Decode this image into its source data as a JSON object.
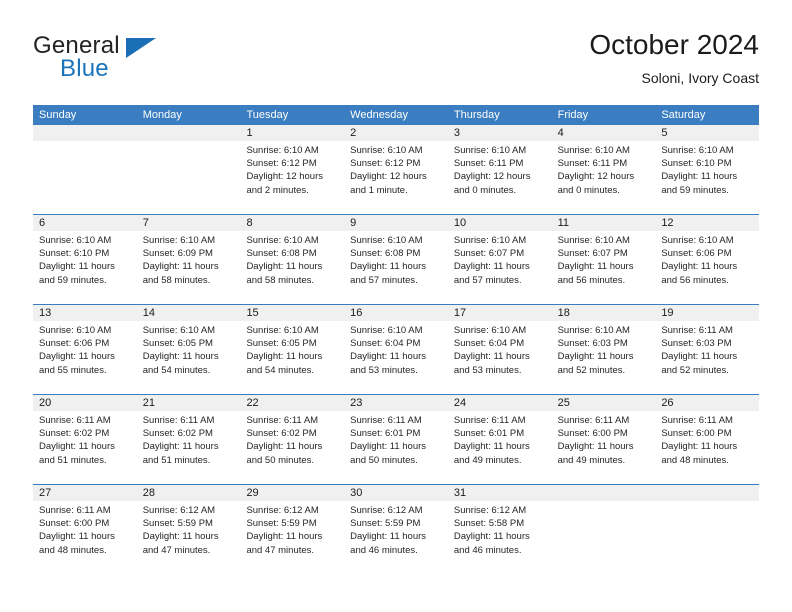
{
  "brand": {
    "word1": "General",
    "word2": "Blue",
    "triangle_color": "#1a6fb5",
    "blue_text_color": "#1a74bb"
  },
  "header": {
    "title": "October 2024",
    "subtitle": "Soloni, Ivory Coast"
  },
  "theme": {
    "header_blue": "#3a7dc0",
    "daynum_gray": "#f0f0f0",
    "text": "#262626"
  },
  "weekdays": [
    "Sunday",
    "Monday",
    "Tuesday",
    "Wednesday",
    "Thursday",
    "Friday",
    "Saturday"
  ],
  "weeks": [
    [
      {
        "day": "",
        "sunrise": "",
        "sunset": "",
        "daylight1": "",
        "daylight2": ""
      },
      {
        "day": "",
        "sunrise": "",
        "sunset": "",
        "daylight1": "",
        "daylight2": ""
      },
      {
        "day": "1",
        "sunrise": "Sunrise: 6:10 AM",
        "sunset": "Sunset: 6:12 PM",
        "daylight1": "Daylight: 12 hours",
        "daylight2": "and 2 minutes."
      },
      {
        "day": "2",
        "sunrise": "Sunrise: 6:10 AM",
        "sunset": "Sunset: 6:12 PM",
        "daylight1": "Daylight: 12 hours",
        "daylight2": "and 1 minute."
      },
      {
        "day": "3",
        "sunrise": "Sunrise: 6:10 AM",
        "sunset": "Sunset: 6:11 PM",
        "daylight1": "Daylight: 12 hours",
        "daylight2": "and 0 minutes."
      },
      {
        "day": "4",
        "sunrise": "Sunrise: 6:10 AM",
        "sunset": "Sunset: 6:11 PM",
        "daylight1": "Daylight: 12 hours",
        "daylight2": "and 0 minutes."
      },
      {
        "day": "5",
        "sunrise": "Sunrise: 6:10 AM",
        "sunset": "Sunset: 6:10 PM",
        "daylight1": "Daylight: 11 hours",
        "daylight2": "and 59 minutes."
      }
    ],
    [
      {
        "day": "6",
        "sunrise": "Sunrise: 6:10 AM",
        "sunset": "Sunset: 6:10 PM",
        "daylight1": "Daylight: 11 hours",
        "daylight2": "and 59 minutes."
      },
      {
        "day": "7",
        "sunrise": "Sunrise: 6:10 AM",
        "sunset": "Sunset: 6:09 PM",
        "daylight1": "Daylight: 11 hours",
        "daylight2": "and 58 minutes."
      },
      {
        "day": "8",
        "sunrise": "Sunrise: 6:10 AM",
        "sunset": "Sunset: 6:08 PM",
        "daylight1": "Daylight: 11 hours",
        "daylight2": "and 58 minutes."
      },
      {
        "day": "9",
        "sunrise": "Sunrise: 6:10 AM",
        "sunset": "Sunset: 6:08 PM",
        "daylight1": "Daylight: 11 hours",
        "daylight2": "and 57 minutes."
      },
      {
        "day": "10",
        "sunrise": "Sunrise: 6:10 AM",
        "sunset": "Sunset: 6:07 PM",
        "daylight1": "Daylight: 11 hours",
        "daylight2": "and 57 minutes."
      },
      {
        "day": "11",
        "sunrise": "Sunrise: 6:10 AM",
        "sunset": "Sunset: 6:07 PM",
        "daylight1": "Daylight: 11 hours",
        "daylight2": "and 56 minutes."
      },
      {
        "day": "12",
        "sunrise": "Sunrise: 6:10 AM",
        "sunset": "Sunset: 6:06 PM",
        "daylight1": "Daylight: 11 hours",
        "daylight2": "and 56 minutes."
      }
    ],
    [
      {
        "day": "13",
        "sunrise": "Sunrise: 6:10 AM",
        "sunset": "Sunset: 6:06 PM",
        "daylight1": "Daylight: 11 hours",
        "daylight2": "and 55 minutes."
      },
      {
        "day": "14",
        "sunrise": "Sunrise: 6:10 AM",
        "sunset": "Sunset: 6:05 PM",
        "daylight1": "Daylight: 11 hours",
        "daylight2": "and 54 minutes."
      },
      {
        "day": "15",
        "sunrise": "Sunrise: 6:10 AM",
        "sunset": "Sunset: 6:05 PM",
        "daylight1": "Daylight: 11 hours",
        "daylight2": "and 54 minutes."
      },
      {
        "day": "16",
        "sunrise": "Sunrise: 6:10 AM",
        "sunset": "Sunset: 6:04 PM",
        "daylight1": "Daylight: 11 hours",
        "daylight2": "and 53 minutes."
      },
      {
        "day": "17",
        "sunrise": "Sunrise: 6:10 AM",
        "sunset": "Sunset: 6:04 PM",
        "daylight1": "Daylight: 11 hours",
        "daylight2": "and 53 minutes."
      },
      {
        "day": "18",
        "sunrise": "Sunrise: 6:10 AM",
        "sunset": "Sunset: 6:03 PM",
        "daylight1": "Daylight: 11 hours",
        "daylight2": "and 52 minutes."
      },
      {
        "day": "19",
        "sunrise": "Sunrise: 6:11 AM",
        "sunset": "Sunset: 6:03 PM",
        "daylight1": "Daylight: 11 hours",
        "daylight2": "and 52 minutes."
      }
    ],
    [
      {
        "day": "20",
        "sunrise": "Sunrise: 6:11 AM",
        "sunset": "Sunset: 6:02 PM",
        "daylight1": "Daylight: 11 hours",
        "daylight2": "and 51 minutes."
      },
      {
        "day": "21",
        "sunrise": "Sunrise: 6:11 AM",
        "sunset": "Sunset: 6:02 PM",
        "daylight1": "Daylight: 11 hours",
        "daylight2": "and 51 minutes."
      },
      {
        "day": "22",
        "sunrise": "Sunrise: 6:11 AM",
        "sunset": "Sunset: 6:02 PM",
        "daylight1": "Daylight: 11 hours",
        "daylight2": "and 50 minutes."
      },
      {
        "day": "23",
        "sunrise": "Sunrise: 6:11 AM",
        "sunset": "Sunset: 6:01 PM",
        "daylight1": "Daylight: 11 hours",
        "daylight2": "and 50 minutes."
      },
      {
        "day": "24",
        "sunrise": "Sunrise: 6:11 AM",
        "sunset": "Sunset: 6:01 PM",
        "daylight1": "Daylight: 11 hours",
        "daylight2": "and 49 minutes."
      },
      {
        "day": "25",
        "sunrise": "Sunrise: 6:11 AM",
        "sunset": "Sunset: 6:00 PM",
        "daylight1": "Daylight: 11 hours",
        "daylight2": "and 49 minutes."
      },
      {
        "day": "26",
        "sunrise": "Sunrise: 6:11 AM",
        "sunset": "Sunset: 6:00 PM",
        "daylight1": "Daylight: 11 hours",
        "daylight2": "and 48 minutes."
      }
    ],
    [
      {
        "day": "27",
        "sunrise": "Sunrise: 6:11 AM",
        "sunset": "Sunset: 6:00 PM",
        "daylight1": "Daylight: 11 hours",
        "daylight2": "and 48 minutes."
      },
      {
        "day": "28",
        "sunrise": "Sunrise: 6:12 AM",
        "sunset": "Sunset: 5:59 PM",
        "daylight1": "Daylight: 11 hours",
        "daylight2": "and 47 minutes."
      },
      {
        "day": "29",
        "sunrise": "Sunrise: 6:12 AM",
        "sunset": "Sunset: 5:59 PM",
        "daylight1": "Daylight: 11 hours",
        "daylight2": "and 47 minutes."
      },
      {
        "day": "30",
        "sunrise": "Sunrise: 6:12 AM",
        "sunset": "Sunset: 5:59 PM",
        "daylight1": "Daylight: 11 hours",
        "daylight2": "and 46 minutes."
      },
      {
        "day": "31",
        "sunrise": "Sunrise: 6:12 AM",
        "sunset": "Sunset: 5:58 PM",
        "daylight1": "Daylight: 11 hours",
        "daylight2": "and 46 minutes."
      },
      {
        "day": "",
        "sunrise": "",
        "sunset": "",
        "daylight1": "",
        "daylight2": ""
      },
      {
        "day": "",
        "sunrise": "",
        "sunset": "",
        "daylight1": "",
        "daylight2": ""
      }
    ]
  ]
}
